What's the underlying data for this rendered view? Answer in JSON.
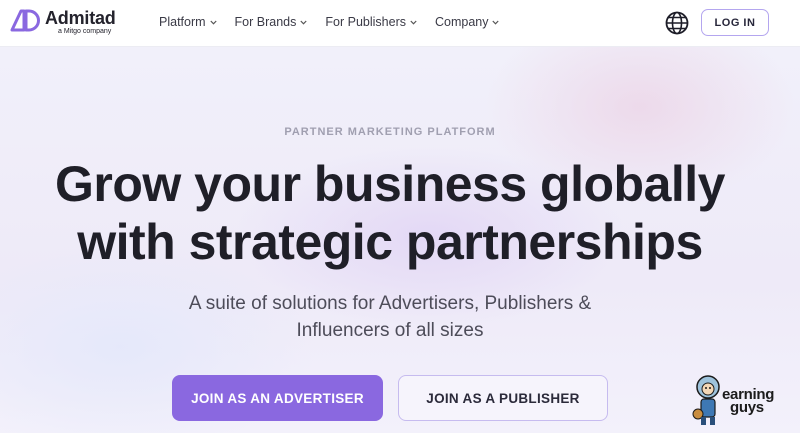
{
  "brand": {
    "name": "Admitad",
    "tagline": "a Mitgo company",
    "accent": "#8a68e0"
  },
  "nav": {
    "items": [
      {
        "label": "Platform"
      },
      {
        "label": "For Brands"
      },
      {
        "label": "For Publishers"
      },
      {
        "label": "Company"
      }
    ]
  },
  "header": {
    "login_label": "LOG IN",
    "globe_icon": "globe-icon"
  },
  "hero": {
    "eyebrow": "PARTNER MARKETING PLATFORM",
    "headline_line1": "Grow your business globally",
    "headline_line2": "with strategic partnerships",
    "sub_line1": "A suite of solutions for Advertisers, Publishers &",
    "sub_line2": "Influencers of all sizes",
    "cta_advertiser": "JOIN AS AN ADVERTISER",
    "cta_publisher": "JOIN AS A PUBLISHER"
  },
  "watermark": {
    "line1": "earning",
    "line2": "guys"
  }
}
